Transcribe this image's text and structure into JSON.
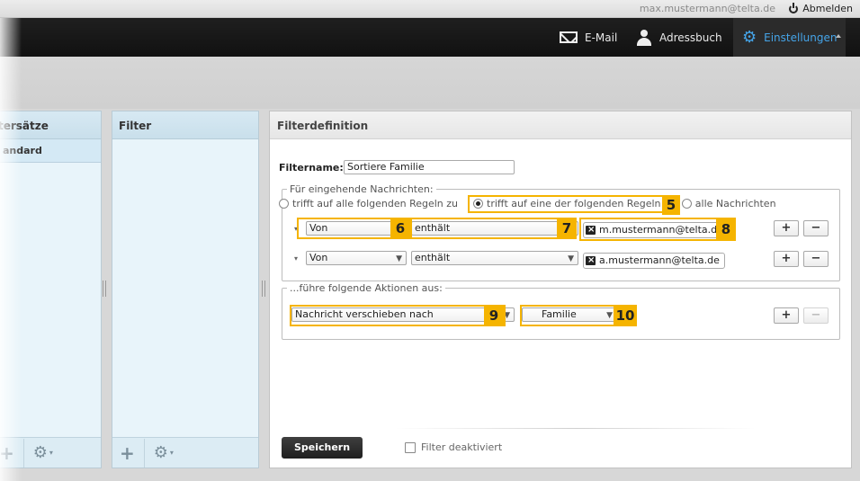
{
  "topbar": {
    "user": "max.mustermann@telta.de",
    "logout": "Abmelden"
  },
  "nav": {
    "email": "E-Mail",
    "addressbook": "Adressbuch",
    "settings": "Einstellungen"
  },
  "panels": {
    "filtersets_title": "tersätze",
    "filtersets_item": "andard",
    "filter_title": "Filter"
  },
  "main": {
    "title": "Filterdefinition",
    "filtername_label": "Filtername:",
    "filtername_value": "Sortiere Familie",
    "incoming_legend": "Für eingehende Nachrichten:",
    "radio_all_rules": "trifft auf alle folgenden Regeln zu",
    "radio_any_rule": "trifft auf eine der folgenden Regeln z",
    "radio_all_messages": "alle Nachrichten",
    "rules": [
      {
        "field": "Von",
        "op": "enthält",
        "address": "m.mustermann@telta.de"
      },
      {
        "field": "Von",
        "op": "enthält",
        "address": "a.mustermann@telta.de"
      }
    ],
    "actions_legend": "...führe folgende Aktionen aus:",
    "action": "Nachricht verschieben nach",
    "folder": "Familie",
    "plus": "+",
    "minus": "−",
    "save": "Speichern",
    "disable_filter": "Filter deaktiviert"
  },
  "callouts": {
    "c5": "5",
    "c6": "6",
    "c7": "7",
    "c8": "8",
    "c9": "9",
    "c10": "10"
  },
  "colors": {
    "accent": "#45a4e8",
    "callout": "#f5b400",
    "panel": "#e8f4fa"
  }
}
